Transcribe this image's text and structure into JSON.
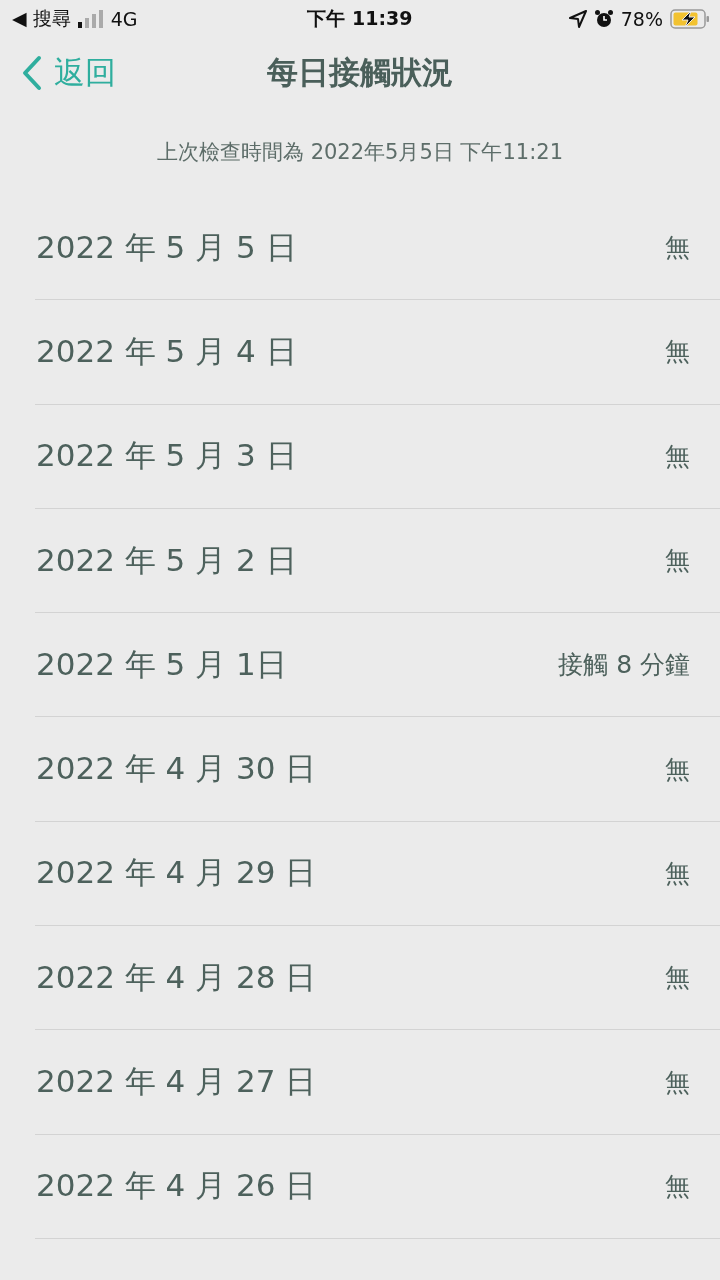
{
  "status_bar": {
    "back_app": "◀ 搜尋",
    "network": "4G",
    "time": "下午 11:39",
    "battery": "78%"
  },
  "nav": {
    "back": "返回",
    "title": "每日接觸狀況"
  },
  "last_checked": "上次檢查時間為 2022年5月5日 下午11:21",
  "days": [
    {
      "date": "2022 年 5 月 5 日",
      "status": "無"
    },
    {
      "date": "2022 年 5 月 4 日",
      "status": "無"
    },
    {
      "date": "2022 年 5 月 3 日",
      "status": "無"
    },
    {
      "date": "2022 年 5 月 2 日",
      "status": "無"
    },
    {
      "date": "2022 年 5 月 1日",
      "status": "接觸 8 分鐘"
    },
    {
      "date": "2022 年 4 月 30 日",
      "status": "無"
    },
    {
      "date": "2022 年 4 月 29 日",
      "status": "無"
    },
    {
      "date": "2022 年 4 月 28 日",
      "status": "無"
    },
    {
      "date": "2022 年 4 月 27 日",
      "status": "無"
    },
    {
      "date": "2022 年 4 月 26 日",
      "status": "無"
    }
  ]
}
